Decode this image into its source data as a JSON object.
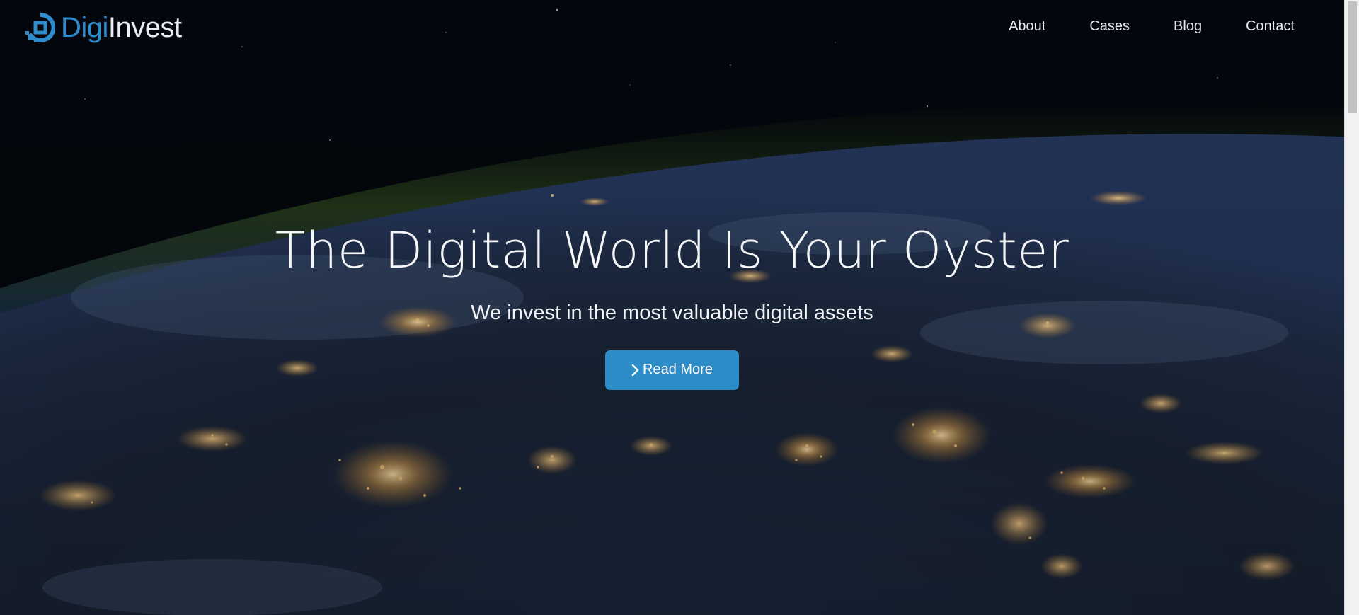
{
  "brand": {
    "name_part1": "Digi",
    "name_part2": "Invest",
    "logo_icon": "digiinvest-logo-icon",
    "colors": {
      "accent": "#2e8bcc",
      "text": "#e8eef4"
    }
  },
  "nav": {
    "items": [
      {
        "label": "About"
      },
      {
        "label": "Cases"
      },
      {
        "label": "Blog"
      },
      {
        "label": "Contact"
      }
    ]
  },
  "hero": {
    "title": "The Digital World Is Your Oyster",
    "subtitle": "We invest in the most valuable digital assets",
    "background": "earth-at-night-from-space",
    "cta": {
      "label": "Read More",
      "icon": "chevron-right-icon",
      "color": "#2d8dc9"
    }
  },
  "scrollbar": {
    "position": 0.0
  }
}
